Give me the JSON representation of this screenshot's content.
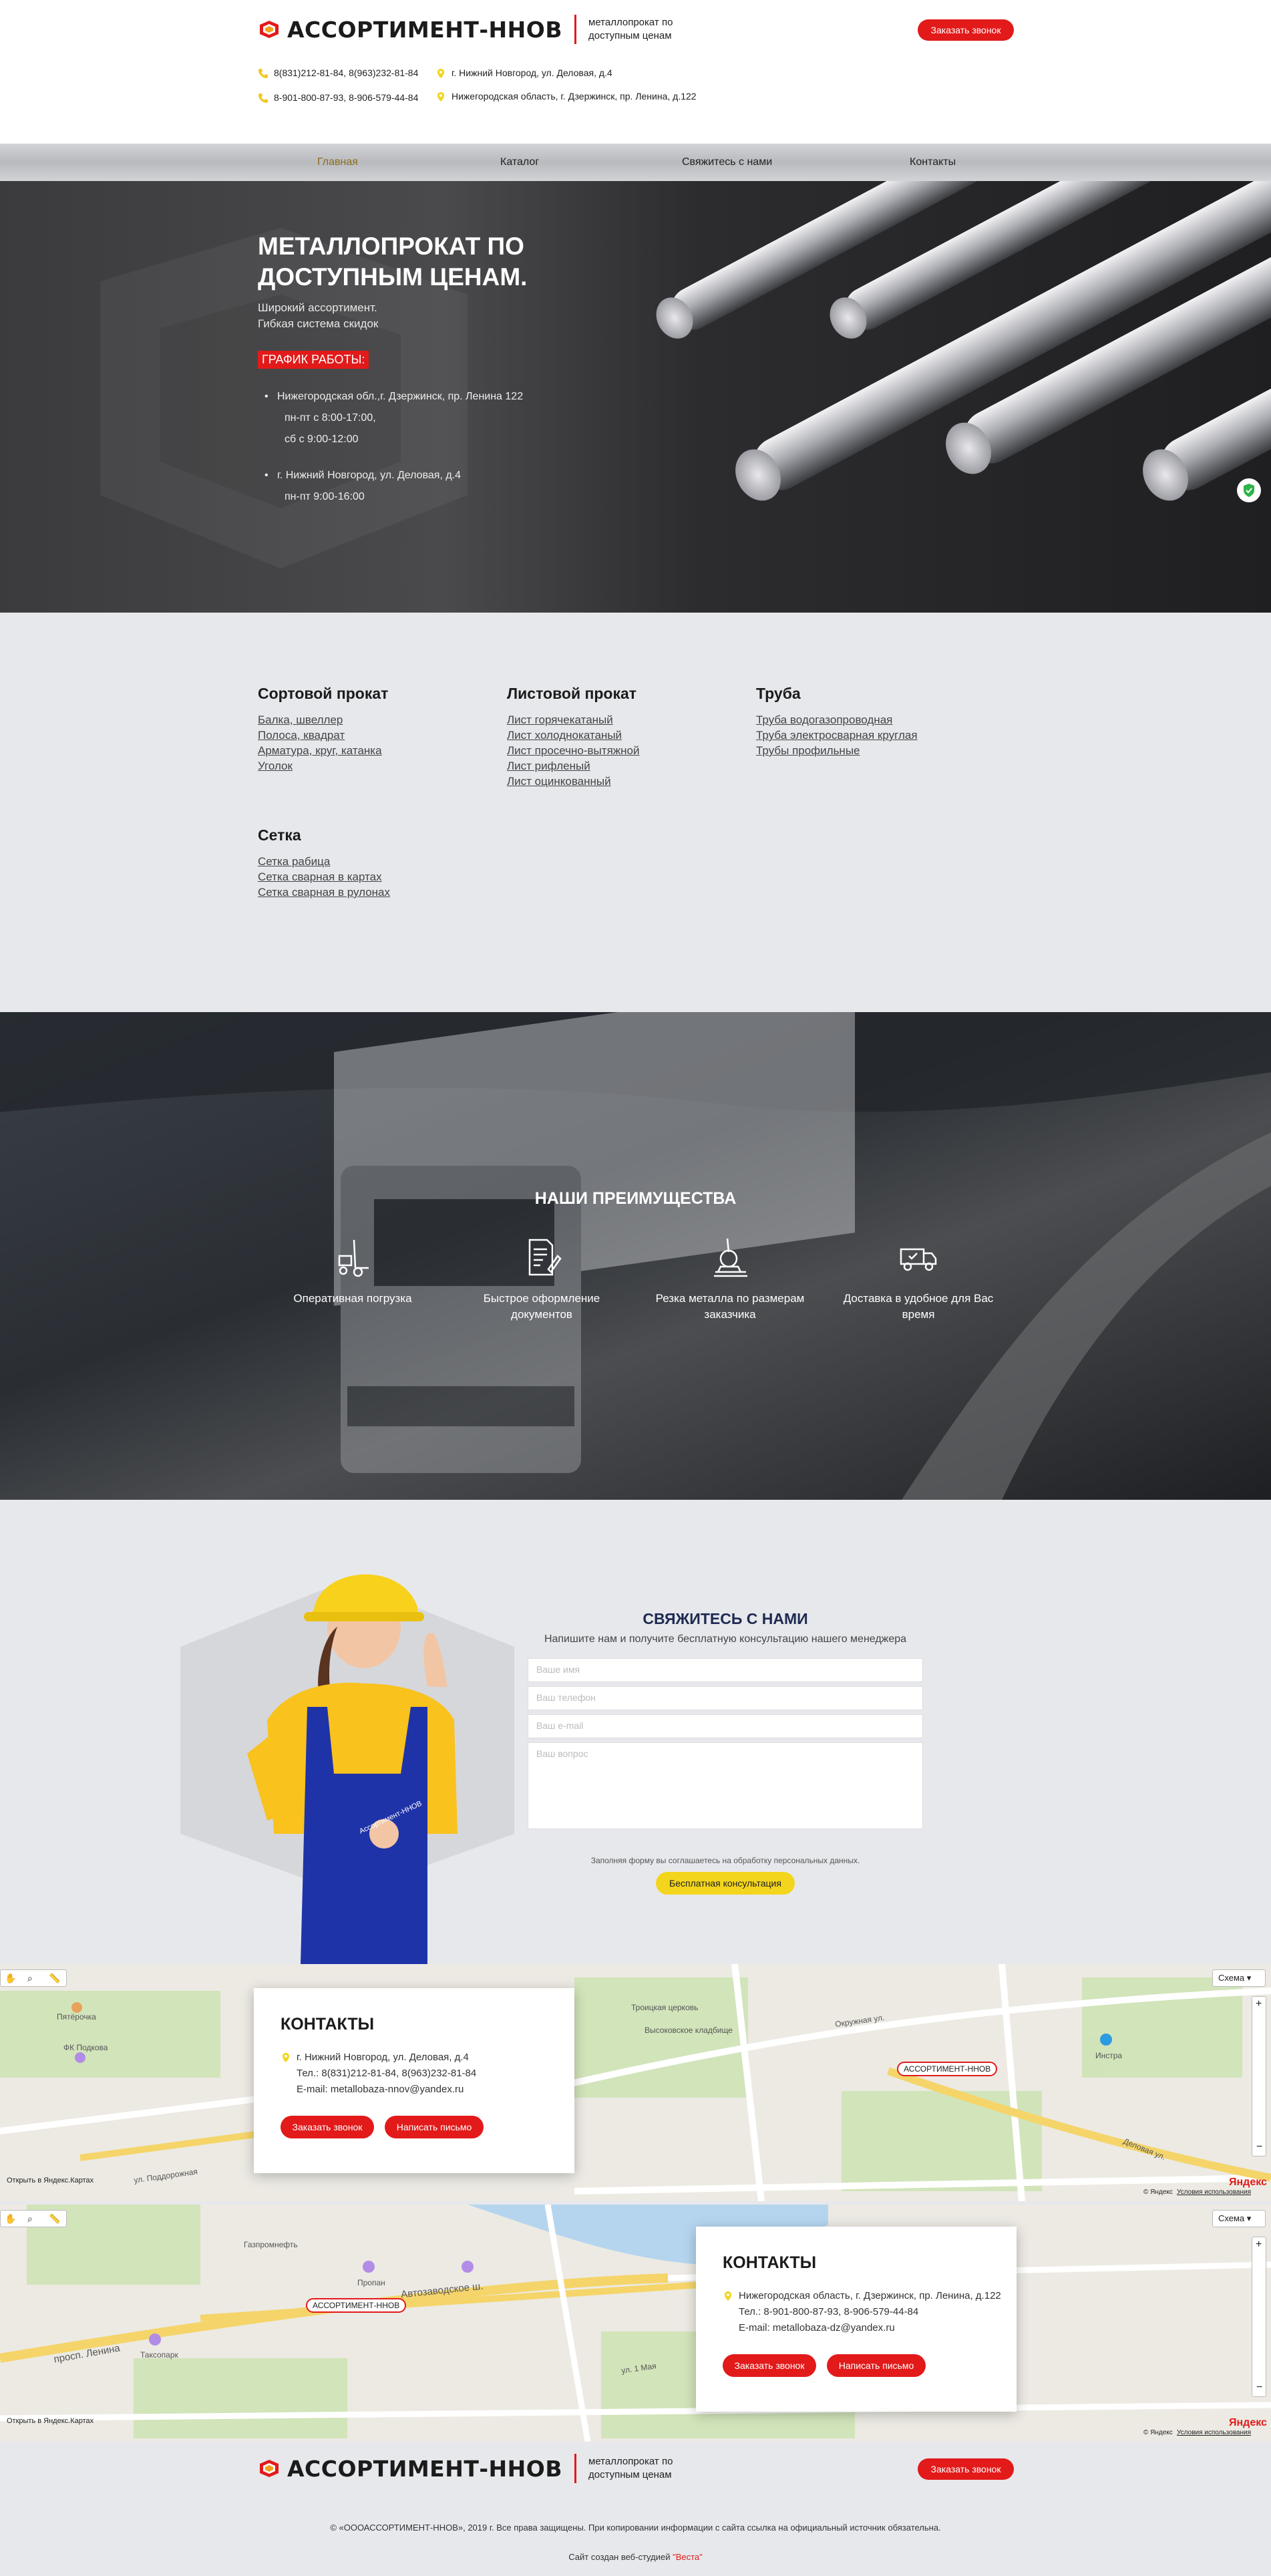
{
  "brand": {
    "name": "АССОРТИМЕНТ-ННОВ",
    "tagline_1": "металлопрокат по",
    "tagline_2": "доступным ценам"
  },
  "header": {
    "callback_label": "Заказать звонок",
    "phones_1": "8(831)212-81-84, 8(963)232-81-84",
    "phones_2": "8-901-800-87-93, 8-906-579-44-84",
    "address_1": "г. Нижний Новгород, ул. Деловая, д.4",
    "address_2": "Нижегородская область, г. Дзержинск, пр. Ленина, д.122"
  },
  "nav": {
    "items": [
      "Главная",
      "Каталог",
      "Свяжитесь с нами",
      "Контакты"
    ]
  },
  "hero": {
    "title_1": "МЕТАЛЛОПРОКАТ ПО",
    "title_2": "ДОСТУПНЫМ ЦЕНАМ.",
    "sub_1": "Широкий ассортимент.",
    "sub_2": "Гибкая система скидок",
    "schedule_label": "ГРАФИК РАБОТЫ:",
    "loc1_addr": "Нижегородская обл.,г. Дзержинск, пр. Ленина 122",
    "loc1_hours1": "пн-пт с 8:00-17:00,",
    "loc1_hours2": "сб с 9:00-12:00",
    "loc2_addr": "г. Нижний Новгород, ул. Деловая, д.4",
    "loc2_hours": "пн-пт  9:00-16:00"
  },
  "catalog": {
    "groups": [
      {
        "title": "Сортовой прокат",
        "links": [
          "Балка, швеллер",
          "Полоса, квадрат",
          "Арматура, круг, катанка",
          "Уголок"
        ]
      },
      {
        "title": "Листовой прокат",
        "links": [
          "Лист горячекатаный",
          "Лист холоднокатаный",
          "Лист просечно-вытяжной",
          "Лист рифленый",
          "Лист оцинкованный"
        ]
      },
      {
        "title": "Труба",
        "links": [
          "Труба водогазопроводная",
          "Труба электросварная круглая",
          "Трубы профильные"
        ]
      },
      {
        "title": "Сетка",
        "links": [
          "Сетка рабица",
          "Сетка сварная в картах",
          "Сетка сварная в рулонах"
        ]
      }
    ]
  },
  "advantages": {
    "title": "НАШИ ПРЕИМУЩЕСТВА",
    "items": [
      {
        "label_1": "Оперативная погрузка",
        "label_2": "",
        "icon": "forklift-icon"
      },
      {
        "label_1": "Быстрое оформление",
        "label_2": "документов",
        "icon": "document-icon"
      },
      {
        "label_1": "Резка металла по размерам",
        "label_2": "заказчика",
        "icon": "saw-icon"
      },
      {
        "label_1": "Доставка в удобное для Вас",
        "label_2": "время",
        "icon": "truck-icon"
      }
    ]
  },
  "contact_form": {
    "title": "СВЯЖИТЕСЬ С НАМИ",
    "subtitle": "Напишите нам и получите бесплатную консультацию нашего менеджера",
    "name_placeholder": "Ваше имя",
    "phone_placeholder": "Ваш телефон",
    "email_placeholder": "Ваш e-mail",
    "question_placeholder": "Ваш вопрос",
    "consent": "Заполняя форму вы соглашаетесь на обработку персональных данных.",
    "submit_label": "Бесплатная консультация",
    "overall_text": "Ассортимент-ННОВ"
  },
  "contacts_1": {
    "title": "КОНТАКТЫ",
    "address": "г. Нижний Новгород, ул. Деловая, д.4",
    "phones": "Тел.: 8(831)212-81-84, 8(963)232-81-84",
    "email": "E-mail: metallobaza-nnov@yandex.ru",
    "call_label": "Заказать звонок",
    "mail_label": "Написать письмо",
    "map_marker": "АССОРТИМЕНТ-ННОВ",
    "map_type": "Схема",
    "open_in_maps": "Открыть в Яндекс.Картах",
    "yandex": "Яндекс",
    "terms": "Условия использования",
    "copyright": "© Яндекс",
    "places": [
      "Пятёрочка",
      "Троицкая церковь",
      "Высоковское кладбище",
      "Окружная ул.",
      "Инстра",
      "Деловая ул.",
      "ул. Поддорожная",
      "ФК Подкова"
    ]
  },
  "contacts_2": {
    "title": "КОНТАКТЫ",
    "address": "Нижегородская область, г. Дзержинск, пр. Ленина, д.122",
    "phones": "Тел.: 8-901-800-87-93, 8-906-579-44-84",
    "email": "E-mail: metallobaza-dz@yandex.ru",
    "call_label": "Заказать звонок",
    "mail_label": "Написать письмо",
    "map_marker": "АССОРТИМЕНТ-ННОВ",
    "map_type": "Схема",
    "open_in_maps": "Открыть в Яндекс.Картах",
    "yandex": "Яндекс",
    "terms": "Условия использования",
    "copyright": "© Яндекс",
    "places": [
      "Газпромнефть",
      "Пропан",
      "Автозаводское ш.",
      "просп. Ленина",
      "Таксопарк",
      "ул. 1 Мая"
    ]
  },
  "footer": {
    "callback_label": "Заказать звонок",
    "copyright": "© «ОООАССОРТИМЕНТ-ННОВ», 2019 г. Все права защищены. При копировании информации с сайта ссылка на официальный источник обязательна.",
    "credit_prefix": "Сайт создан веб-студией",
    "credit_studio": "\"Веста\""
  },
  "colors": {
    "accent": "#e21a1a",
    "yellow": "#f3d51d",
    "background": "#e7e8ec"
  }
}
